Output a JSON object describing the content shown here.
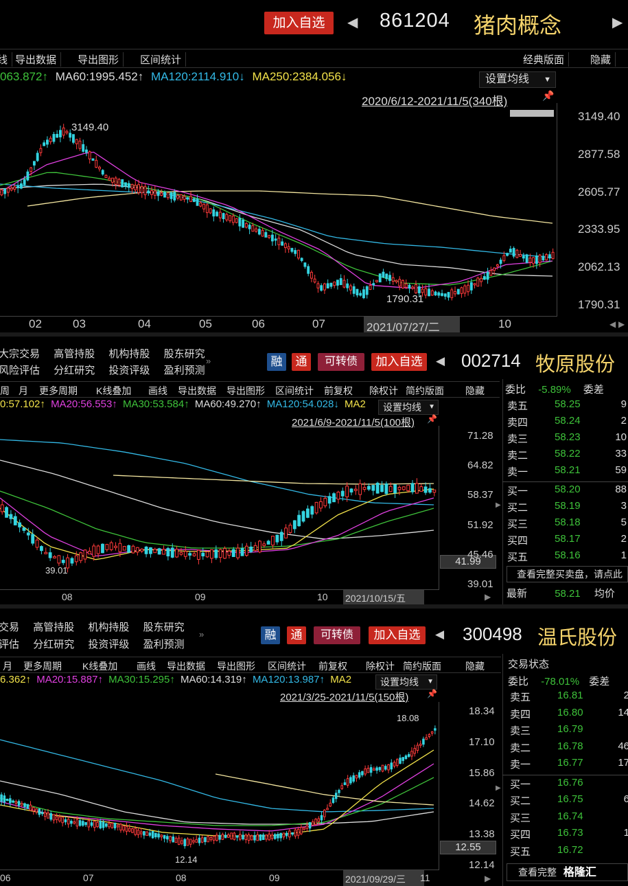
{
  "p1": {
    "add_btn": "加入自选",
    "code": "861204",
    "name": "猪肉概念",
    "toolbar": [
      "线",
      "导出数据",
      "导出图形",
      "区间统计"
    ],
    "toolbar_right": [
      "经典版面",
      "隐藏"
    ],
    "ma": [
      "063.872↑",
      "MA60:1995.452↑",
      "MA120:2114.910↓",
      "MA250:2384.056↓"
    ],
    "ma_colors": [
      "#3ec23a",
      "#dddddd",
      "#33b9e6",
      "#f2e24a"
    ],
    "set_ma": "设置均线",
    "range": "2020/6/12-2021/11/5(340根)",
    "yaxis": [
      "3149.40",
      "2877.58",
      "2605.77",
      "2333.95",
      "2062.13",
      "1790.31"
    ],
    "xaxis": [
      "02",
      "03",
      "04",
      "05",
      "06",
      "07",
      "2021/07/27/二",
      "10"
    ],
    "high_label": "3149.40",
    "low_label": "1790.31"
  },
  "p2": {
    "menu_row1": [
      "大宗交易",
      "高管持股",
      "机构持股",
      "股东研究"
    ],
    "menu_row2": [
      "风险评估",
      "分红研究",
      "投资评级",
      "盈利预测"
    ],
    "btn_rong": "融",
    "btn_tong": "通",
    "btn_kzz": "可转债",
    "add_btn": "加入自选",
    "code": "002714",
    "name": "牧原股份",
    "toolbar": [
      "周",
      "月",
      "更多周期",
      "K线叠加",
      "画线",
      "导出数据",
      "导出图形",
      "区间统计",
      "前复权",
      "除权计",
      "简约版面",
      "隐藏"
    ],
    "ma": [
      "0:57.102↑",
      "MA20:56.553↑",
      "MA30:53.584↑",
      "MA60:49.270↑",
      "MA120:54.028↓",
      "MA2"
    ],
    "ma_colors": [
      "#f2e24a",
      "#e040e0",
      "#3ec23a",
      "#dddddd",
      "#33b9e6",
      "#f2e24a"
    ],
    "set_ma": "设置均线",
    "range": "2021/6/9-2021/11/5(100根)",
    "yaxis": [
      "71.28",
      "64.82",
      "58.37",
      "51.92",
      "45.46",
      "39.01"
    ],
    "cursor_price": "41.99",
    "xaxis": [
      "08",
      "09",
      "10",
      "2021/10/15/五"
    ],
    "low_label": "39.01",
    "orderbook": {
      "webi_label": "委比",
      "webi_value": "-5.89%",
      "weicha_label": "委差",
      "sells": [
        {
          "label": "卖五",
          "price": "58.25",
          "vol": "9"
        },
        {
          "label": "卖四",
          "price": "58.24",
          "vol": "2"
        },
        {
          "label": "卖三",
          "price": "58.23",
          "vol": "10"
        },
        {
          "label": "卖二",
          "price": "58.22",
          "vol": "33"
        },
        {
          "label": "卖一",
          "price": "58.21",
          "vol": "59"
        }
      ],
      "buys": [
        {
          "label": "买一",
          "price": "58.20",
          "vol": "88"
        },
        {
          "label": "买二",
          "price": "58.19",
          "vol": "3"
        },
        {
          "label": "买三",
          "price": "58.18",
          "vol": "5"
        },
        {
          "label": "买四",
          "price": "58.17",
          "vol": "2"
        },
        {
          "label": "买五",
          "price": "58.16",
          "vol": "1"
        }
      ],
      "view_full": "查看完整买卖盘，请点此",
      "latest_label": "最新",
      "latest_value": "58.21",
      "avg_label": "均价"
    }
  },
  "p3": {
    "menu_row1": [
      "交易",
      "高管持股",
      "机构持股",
      "股东研究"
    ],
    "menu_row2": [
      "评估",
      "分红研究",
      "投资评级",
      "盈利预测"
    ],
    "btn_rong": "融",
    "btn_tong": "通",
    "btn_kzz": "可转债",
    "add_btn": "加入自选",
    "code": "300498",
    "name": "温氏股份",
    "toolbar": [
      "月",
      "更多周期",
      "K线叠加",
      "画线",
      "导出数据",
      "导出图形",
      "区间统计",
      "前复权",
      "除权计",
      "简约版面",
      "隐藏"
    ],
    "ma": [
      "6.362↑",
      "MA20:15.887↑",
      "MA30:15.295↑",
      "MA60:14.319↑",
      "MA120:13.987↑",
      "MA2"
    ],
    "ma_colors": [
      "#f2e24a",
      "#e040e0",
      "#3ec23a",
      "#dddddd",
      "#33b9e6",
      "#f2e24a"
    ],
    "set_ma": "设置均线",
    "range": "2021/3/25-2021/11/5(150根)",
    "yaxis": [
      "18.34",
      "17.10",
      "15.86",
      "14.62",
      "13.38",
      "12.14"
    ],
    "cursor_price": "12.55",
    "xaxis": [
      "06",
      "07",
      "08",
      "09",
      "2021/09/29/三",
      "11"
    ],
    "high_label": "18.08",
    "low_label": "12.14",
    "orderbook": {
      "status_label": "交易状态",
      "webi_label": "委比",
      "webi_value": "-78.01%",
      "weicha_label": "委差",
      "sells": [
        {
          "label": "卖五",
          "price": "16.81",
          "vol": "2"
        },
        {
          "label": "卖四",
          "price": "16.80",
          "vol": "14"
        },
        {
          "label": "卖三",
          "price": "16.79",
          "vol": ""
        },
        {
          "label": "卖二",
          "price": "16.78",
          "vol": "46"
        },
        {
          "label": "卖一",
          "price": "16.77",
          "vol": "17"
        }
      ],
      "buys": [
        {
          "label": "买一",
          "price": "16.76",
          "vol": ""
        },
        {
          "label": "买二",
          "price": "16.75",
          "vol": "6"
        },
        {
          "label": "买三",
          "price": "16.74",
          "vol": ""
        },
        {
          "label": "买四",
          "price": "16.73",
          "vol": "1"
        },
        {
          "label": "买五",
          "price": "16.72",
          "vol": ""
        }
      ],
      "view_full": "查看完整",
      "watermark": "格隆汇"
    }
  }
}
